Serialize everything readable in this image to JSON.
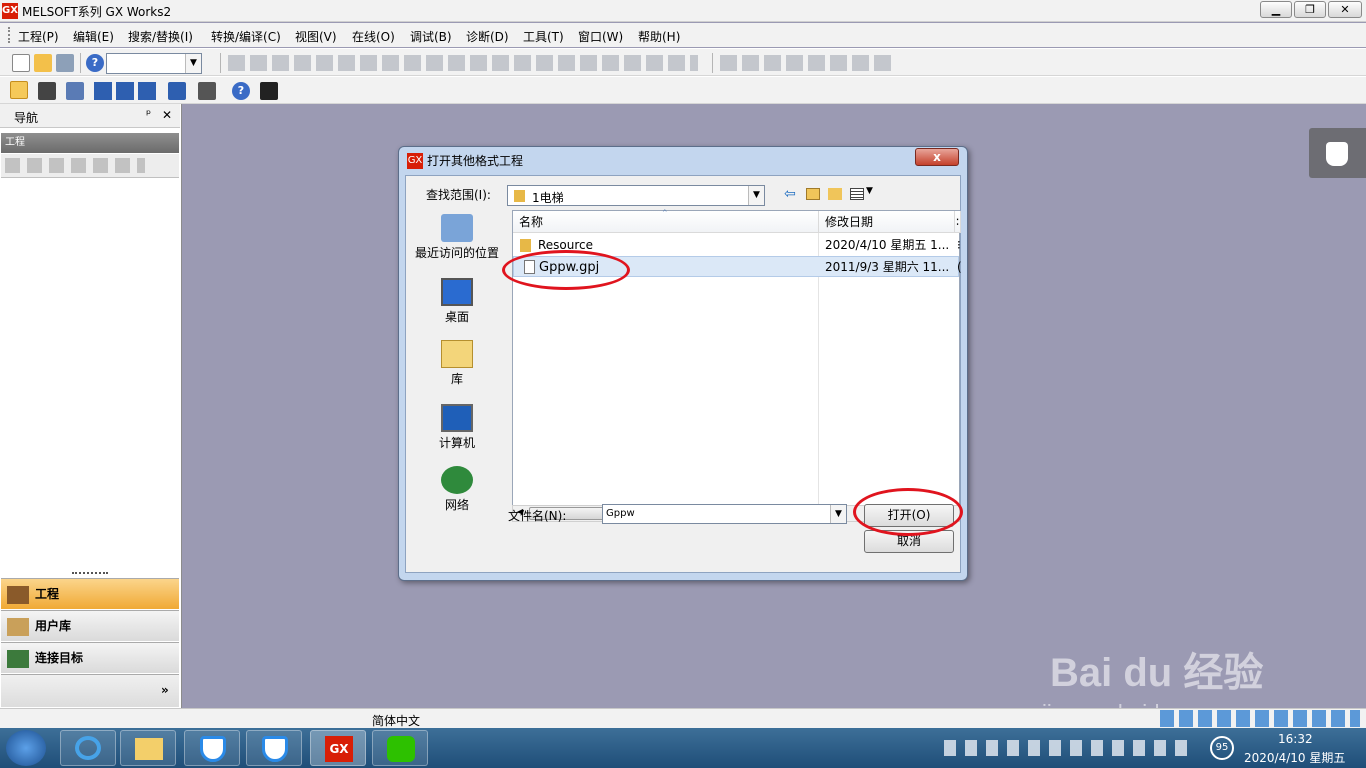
{
  "window": {
    "title": "MELSOFT系列 GX Works2",
    "logo": "GX"
  },
  "menu": [
    "工程(P)",
    "编辑(E)",
    "搜索/替换(I)",
    "转换/编译(C)",
    "视图(V)",
    "在线(O)",
    "调试(B)",
    "诊断(D)",
    "工具(T)",
    "窗口(W)",
    "帮助(H)"
  ],
  "nav": {
    "title": "导航",
    "pin": "ᵖ",
    "close": "✕",
    "project_header": "工程",
    "buttons": [
      "工程",
      "用户库",
      "连接目标"
    ],
    "more": "»"
  },
  "dialog": {
    "title": "打开其他格式工程",
    "close": "x",
    "lookin_label": "查找范围(I):",
    "lookin_value": "1电梯",
    "places": [
      "最近访问的位置",
      "桌面",
      "库",
      "计算机",
      "网络"
    ],
    "columns": [
      "名称",
      "修改日期",
      "∶"
    ],
    "files": [
      {
        "name": "Resource",
        "date": "2020/4/10 星期五 1...",
        "extra": "⁝",
        "type": "folder"
      },
      {
        "name": "Gppw.gpj",
        "date": "2011/9/3 星期六 11...",
        "extra": "(",
        "type": "file"
      }
    ],
    "filename_label": "文件名(N):",
    "filename_value": "Gppw",
    "open_button": "打开(O)",
    "cancel_button": "取消",
    "scroll_grip": "Ⅲ"
  },
  "statusbar": {
    "ime": "简体中文"
  },
  "watermark": {
    "brand": "Bai du 经验",
    "url": "jingyan.baidu.com"
  },
  "taskbar": {
    "time": "16:32",
    "date": "2020/4/10 星期五",
    "badge": "95"
  },
  "colors": {
    "annotation": "#e0141e",
    "accent_orange": "#f5b94a",
    "dialog_frame": "#c3d6ee"
  }
}
